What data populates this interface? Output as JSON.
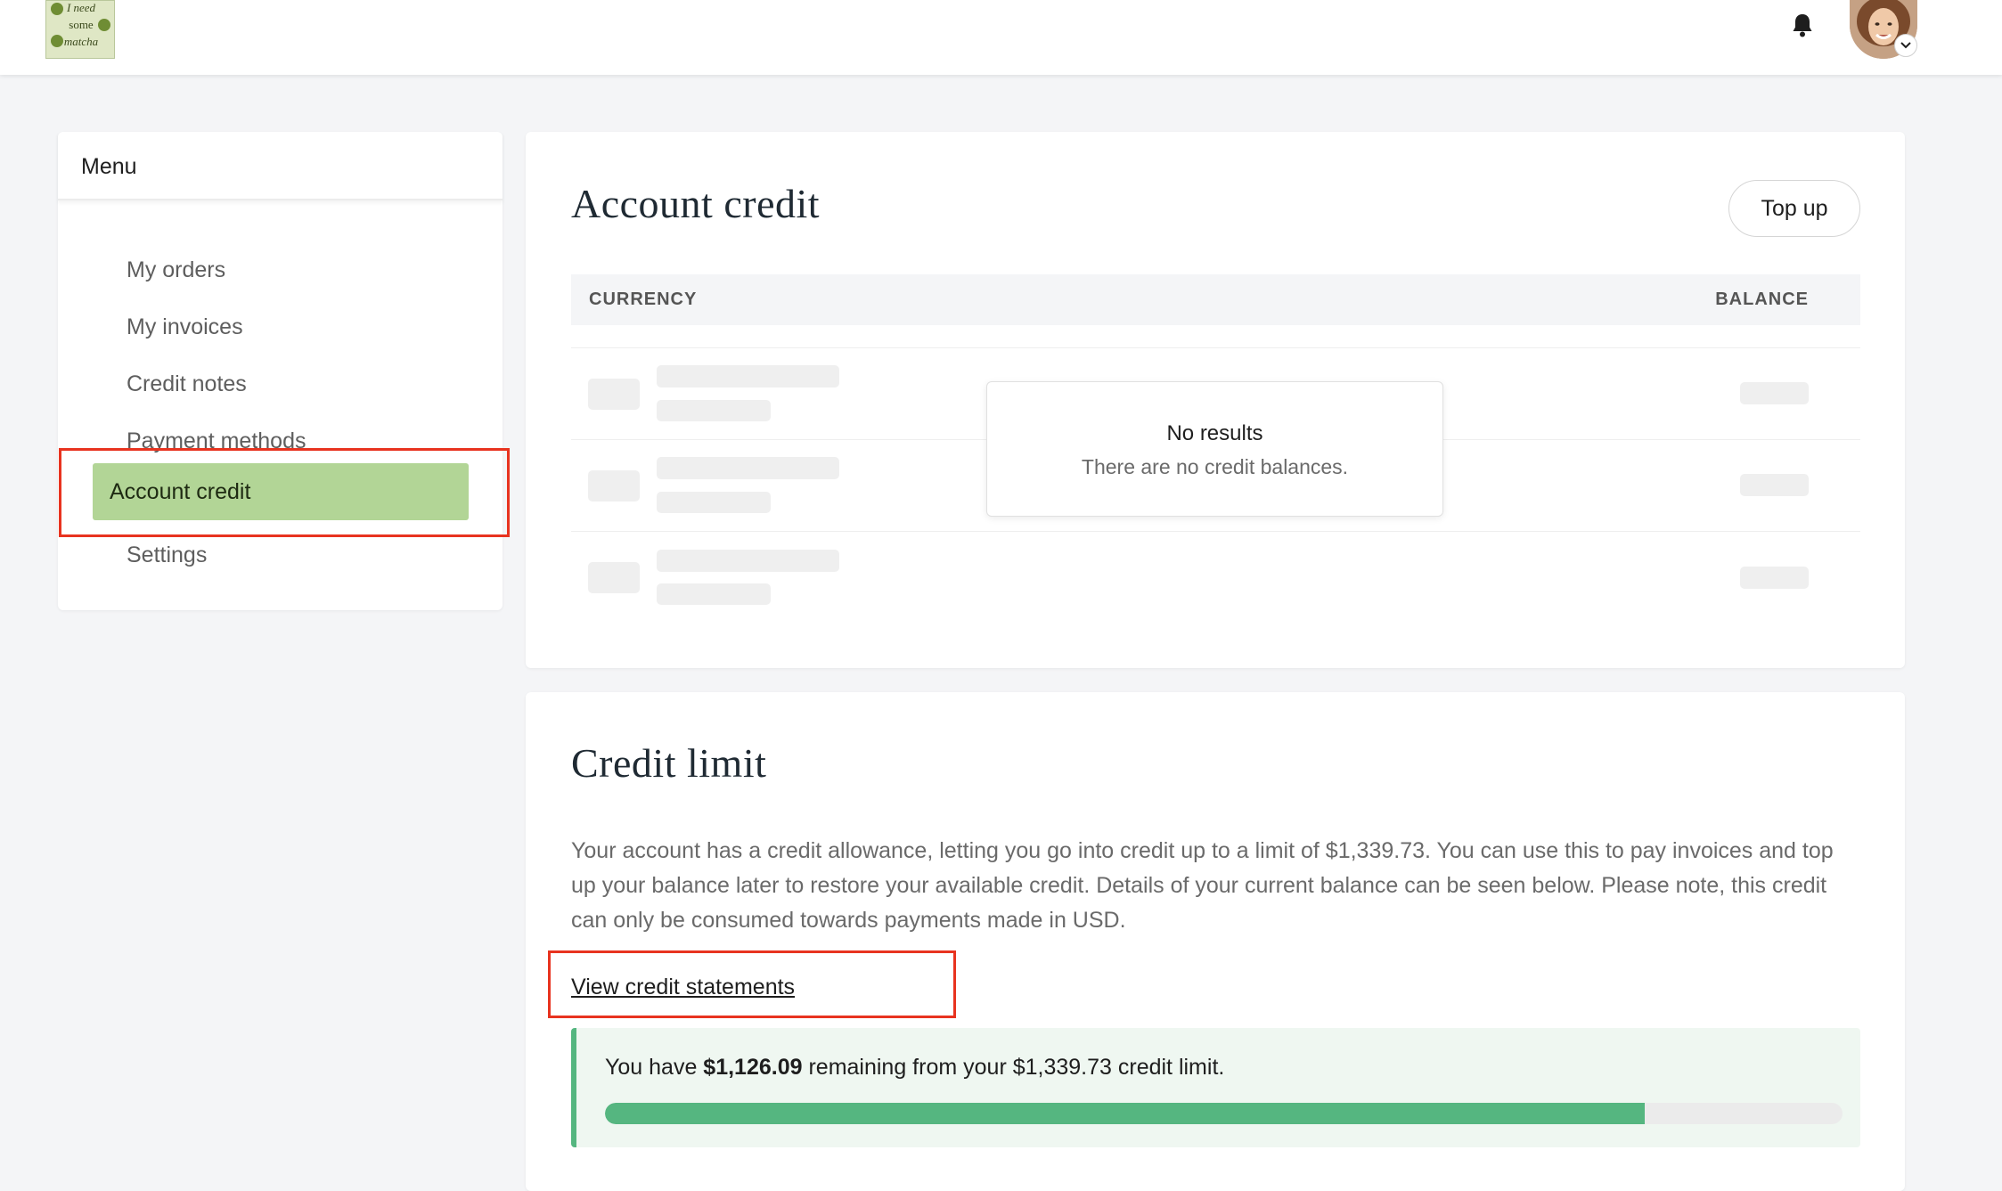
{
  "header": {
    "logo_text": [
      "I need",
      "some",
      "matcha"
    ],
    "bell_icon": "bell-icon",
    "avatar_icon": "user-avatar",
    "chevron_icon": "chevron-down-icon"
  },
  "menu": {
    "title": "Menu",
    "items": [
      {
        "label": "My orders"
      },
      {
        "label": "My invoices"
      },
      {
        "label": "Credit notes"
      },
      {
        "label": "Payment methods"
      },
      {
        "label": "Account credit",
        "active": true
      },
      {
        "label": "Settings"
      }
    ]
  },
  "account_credit": {
    "title": "Account credit",
    "top_up_label": "Top up",
    "columns": [
      "CURRENCY",
      "BALANCE"
    ],
    "empty_title": "No results",
    "empty_message": "There are no credit balances."
  },
  "credit_limit": {
    "title": "Credit limit",
    "description": "Your account has a credit allowance, letting you go into credit up to a limit of $1,339.73. You can use this to pay invoices and top up your balance later to restore your available credit. Details of your current balance can be seen below. Please note, this credit can only be consumed towards payments made in USD.",
    "link_label": "View credit statements",
    "remaining_prefix": "You have ",
    "remaining_amount": "$1,126.09",
    "remaining_suffix": " remaining from your $1,339.73 credit limit.",
    "remaining_fraction": 0.8405
  },
  "colors": {
    "accent_green": "#55b680",
    "active_menu": "#b2d596",
    "highlight_red": "#e8331f"
  }
}
